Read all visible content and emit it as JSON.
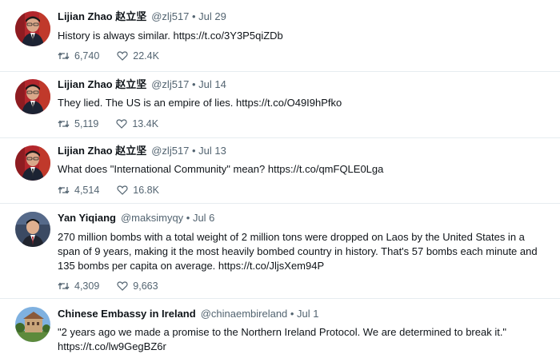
{
  "tweets": [
    {
      "name": "Lijian Zhao 赵立坚",
      "meta": "@zlj517 • Jul 29",
      "text": "History is always similar. https://t.co/3Y3P5qiZDb",
      "retweets": "6,740",
      "likes": "22.4K",
      "avatar": "lijian-zhao"
    },
    {
      "name": "Lijian Zhao 赵立坚",
      "meta": "@zlj517 • Jul 14",
      "text": "They lied. The US is an empire of lies. https://t.co/O49I9hPfko",
      "retweets": "5,119",
      "likes": "13.4K",
      "avatar": "lijian-zhao"
    },
    {
      "name": "Lijian Zhao 赵立坚",
      "meta": "@zlj517 • Jul 13",
      "text": "What does \"International Community\" mean? https://t.co/qmFQLE0Lga",
      "retweets": "4,514",
      "likes": "16.8K",
      "avatar": "lijian-zhao"
    },
    {
      "name": "Yan Yiqiang",
      "meta": "@maksimyqy • Jul 6",
      "text": "270 million bombs with a total weight of 2 million tons were dropped on Laos by the United States in a span of 9 years, making it the most heavily bombed country in history. That's 57 bombs each minute and 135 bombs per capita on average. https://t.co/JljsXem94P",
      "retweets": "4,309",
      "likes": "9,663",
      "avatar": "yan-yiqiang"
    },
    {
      "name": "Chinese Embassy in Ireland",
      "meta": "@chinaembireland • Jul 1",
      "text": "\"2 years ago we made a promise to the Northern Ireland Protocol. We are determined to break it.\" https://t.co/lw9GegBZ6r",
      "retweets": "",
      "likes": "",
      "avatar": "embassy-building"
    }
  ],
  "icons": {
    "retweet": "retweet-icon",
    "like": "heart-icon"
  },
  "colors": {
    "text": "#0f1419",
    "secondary": "#536471",
    "divider": "#e6ecf0"
  }
}
